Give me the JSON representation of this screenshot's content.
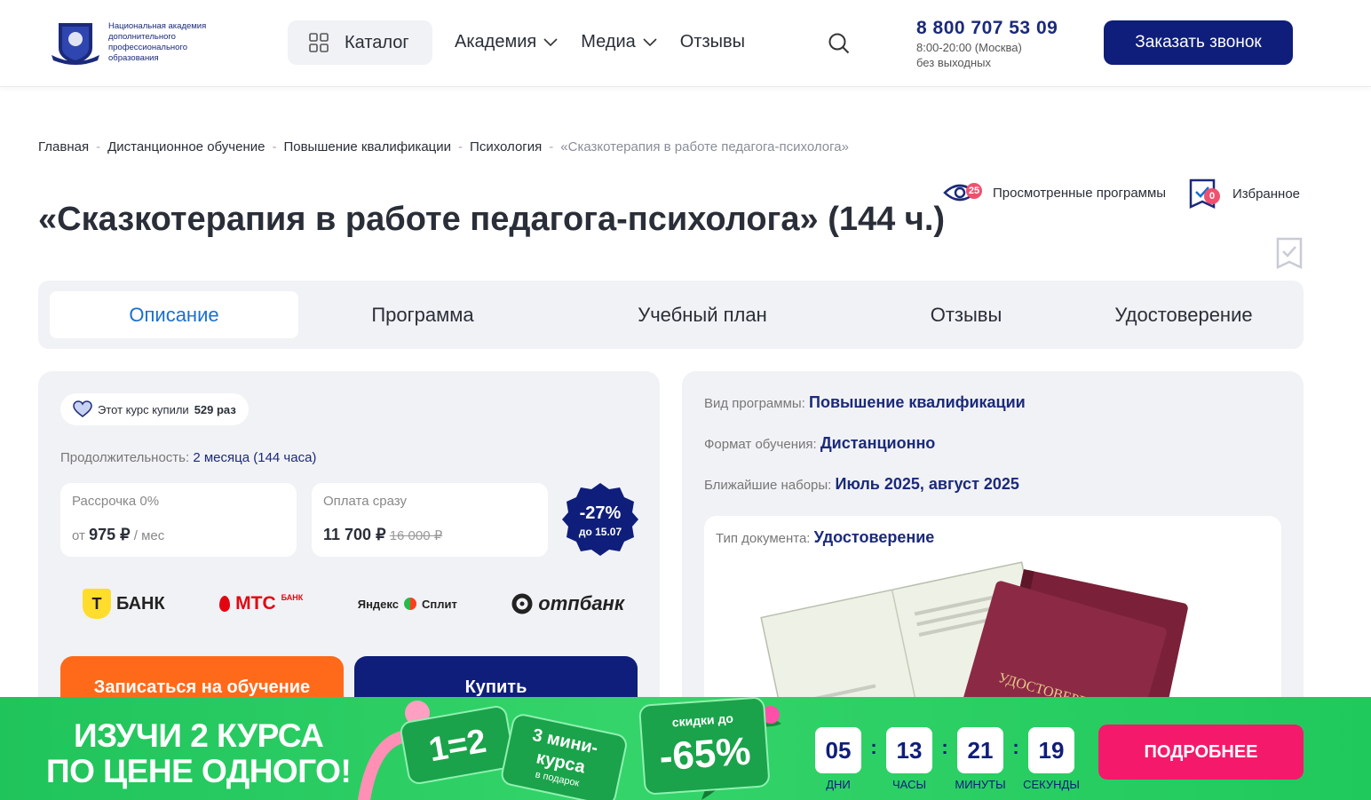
{
  "header": {
    "logo_text": "Национальная академия дополнительного профессионального образования",
    "catalog": "Каталог",
    "nav": [
      {
        "label": "Академия",
        "dropdown": true
      },
      {
        "label": "Медиа",
        "dropdown": true
      },
      {
        "label": "Отзывы",
        "dropdown": false
      }
    ],
    "phone": "8 800 707 53 09",
    "hours": "8:00-20:00 (Москва)",
    "days": "без выходных",
    "call_button": "Заказать звонок"
  },
  "breadcrumbs": [
    "Главная",
    "Дистанционное обучение",
    "Повышение квалификации",
    "Психология"
  ],
  "breadcrumb_current": "«Сказкотерапия в работе педагога-психолога»",
  "viewed": {
    "label": "Просмотренные программы",
    "count": "25"
  },
  "favorites": {
    "label": "Избранное",
    "count": "0"
  },
  "title": "«Сказкотерапия в работе педагога-психолога» (144 ч.)",
  "tabs": [
    "Описание",
    "Программа",
    "Учебный план",
    "Отзывы",
    "Удостоверение"
  ],
  "left": {
    "bought_prefix": "Этот курс купили",
    "bought_count": "529 раз",
    "duration_label": "Продолжительность:",
    "duration_value": "2 месяца (144 часа)",
    "installment": {
      "label": "Рассрочка 0%",
      "prefix": "от",
      "price": "975 ₽",
      "suffix": "/ мес"
    },
    "full": {
      "label": "Оплата сразу",
      "price": "11 700 ₽",
      "old_price": "16 000 ₽"
    },
    "discount": {
      "value": "-27%",
      "until": "до 15.07"
    },
    "banks": [
      "БАНК",
      "МТС",
      "БАНК",
      "Яндекс",
      "Сплит",
      "отпбанк"
    ],
    "enroll": "Записаться на обучение",
    "buy": "Купить"
  },
  "right": {
    "type_label": "Вид программы:",
    "type_value": "Повышение квалификации",
    "format_label": "Формат обучения:",
    "format_value": "Дистанционно",
    "start_label": "Ближайшие наборы:",
    "start_value": "Июль 2025, август 2025",
    "doc_label": "Тип документа:",
    "doc_value": "Удостоверение",
    "doc_image_text": "УДОСТОВЕРЕНИЕ"
  },
  "banner": {
    "line1": "ИЗУЧИ 2 КУРСА",
    "line2": "ПО ЦЕНЕ ОДНОГО!",
    "promo1": "1=2",
    "promo2a": "3 мини-",
    "promo2b": "курса",
    "promo2c": "в подарок",
    "promo3a": "скидки до",
    "promo3b": "-65%",
    "timer": [
      {
        "value": "05",
        "label": "ДНИ"
      },
      {
        "value": "13",
        "label": "ЧАСЫ"
      },
      {
        "value": "21",
        "label": "МИНУТЫ"
      },
      {
        "value": "19",
        "label": "СЕКУНДЫ"
      }
    ],
    "button": "ПОДРОБНЕЕ"
  },
  "colors": {
    "brand": "#0f1e7a",
    "accent": "#ff6a1a",
    "link": "#1a6fd0",
    "banner": "#20c95c",
    "cta": "#f5196b"
  }
}
